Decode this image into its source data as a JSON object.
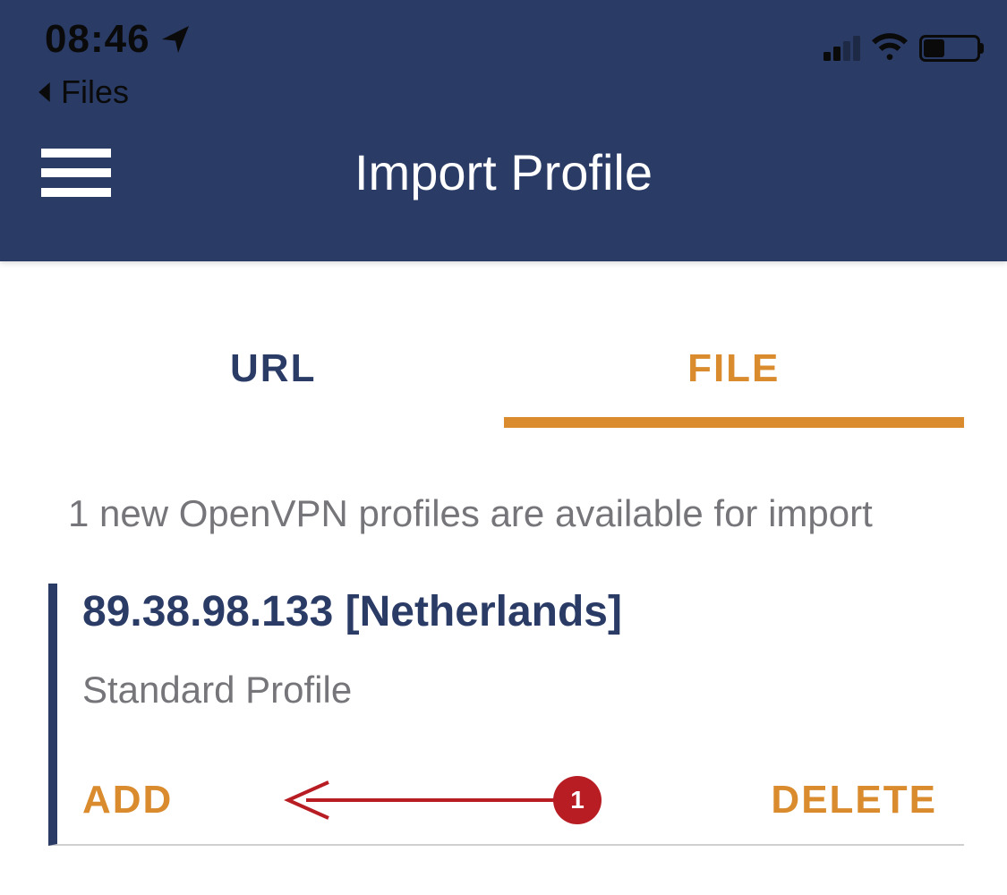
{
  "status_bar": {
    "time": "08:46",
    "back_label": "Files",
    "battery_level_percent": 40
  },
  "header": {
    "title": "Import Profile"
  },
  "tabs": {
    "url_label": "URL",
    "file_label": "FILE",
    "active": "FILE"
  },
  "info_message": "1 new OpenVPN profiles are available for import",
  "profile": {
    "title": "89.38.98.133 [Netherlands]",
    "subtitle": "Standard Profile",
    "add_label": "ADD",
    "delete_label": "DELETE"
  },
  "annotation": {
    "number": "1"
  },
  "colors": {
    "header_bg": "#2a3b66",
    "accent": "#d98b2e",
    "annotation_red": "#b81d24"
  }
}
